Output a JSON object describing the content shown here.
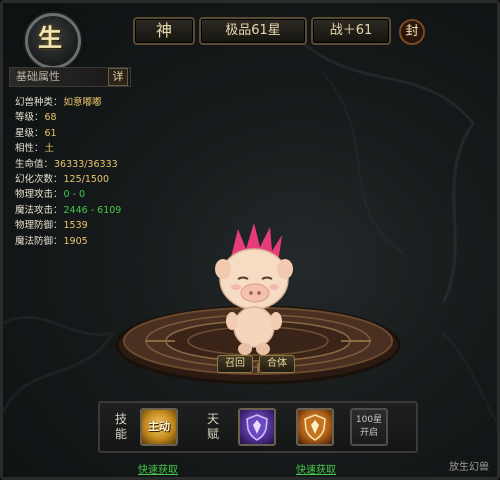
{
  "colors": {
    "accent_gold": "#e9dbb0",
    "value_yellow": "#e7c56a",
    "value_green": "#48c64a",
    "link_green": "#48c64a"
  },
  "emblem": {
    "glyph": "生",
    "icon": "element-earth-emblem"
  },
  "topbar": {
    "god_label": "神",
    "quality_label": "极品61星",
    "power_label": "战＋61",
    "seal_label": "封"
  },
  "section": {
    "title": "基础属性",
    "detail_label": "详"
  },
  "stats": [
    {
      "key": "幻兽种类：",
      "value": "如意嘟嘟",
      "color": "#e7c56a"
    },
    {
      "key": "等级：",
      "value": "68",
      "color": "#e7c56a"
    },
    {
      "key": "星级：",
      "value": "61",
      "color": "#e7c56a"
    },
    {
      "key": "相性：",
      "value": "土",
      "color": "#e7c56a"
    },
    {
      "key": "生命值：",
      "value": "36333/36333",
      "color": "#e7c56a"
    },
    {
      "key": "幻化次数：",
      "value": "125/1500",
      "color": "#e7c56a"
    },
    {
      "key": "物理攻击：",
      "value": "0 - 0",
      "color": "#48c64a"
    },
    {
      "key": "魔法攻击：",
      "value": "2446 - 6109",
      "color": "#48c64a"
    },
    {
      "key": "物理防御：",
      "value": "1539",
      "color": "#e7c56a"
    },
    {
      "key": "魔法防御：",
      "value": "1905",
      "color": "#e7c56a"
    }
  ],
  "actions": {
    "summon_label": "召回",
    "merge_label": "合体"
  },
  "skills": {
    "skill_label": "技能",
    "talent_label": "天赋",
    "active_skill_label": "主动",
    "locked_slot_label": "100星开启"
  },
  "links": {
    "get_skill": "快速获取",
    "get_talent": "快速获取"
  },
  "corner_label": "放生幻兽"
}
